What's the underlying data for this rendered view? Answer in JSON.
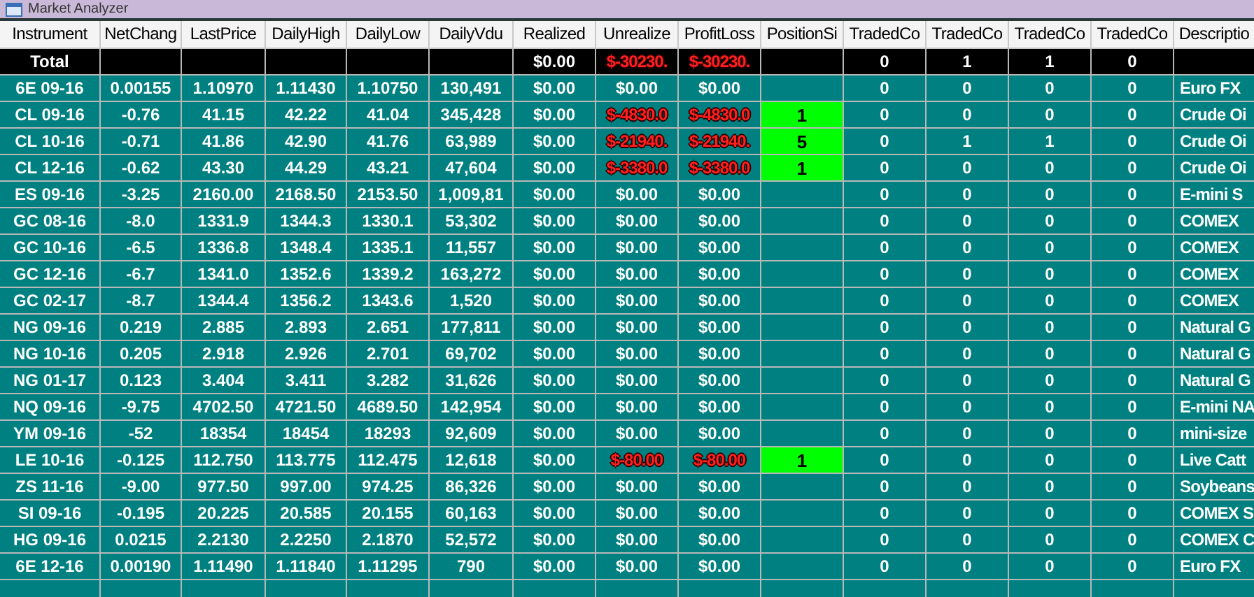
{
  "window": {
    "title": "Market Analyzer"
  },
  "columns": [
    "Instrument",
    "NetChang",
    "LastPrice",
    "DailyHigh",
    "DailyLow",
    "DailyVdu",
    "Realized",
    "Unrealize",
    "ProfitLoss",
    "PositionSi",
    "TradedCo",
    "TradedCo",
    "TradedCo",
    "TradedCo",
    "Descriptio"
  ],
  "rows": [
    {
      "kind": "total",
      "loss": true,
      "position_open": false,
      "cells": [
        "Total",
        null,
        null,
        null,
        null,
        null,
        "$0.00",
        "$-30230.",
        "$-30230.",
        null,
        "0",
        "1",
        "1",
        "0",
        null
      ]
    },
    {
      "kind": "instrument",
      "loss": false,
      "position_open": false,
      "cells": [
        "6E 09-16",
        "0.00155",
        "1.10970",
        "1.11430",
        "1.10750",
        "130,491",
        "$0.00",
        "$0.00",
        "$0.00",
        null,
        "0",
        "0",
        "0",
        "0",
        "Euro FX"
      ]
    },
    {
      "kind": "instrument",
      "loss": true,
      "position_open": true,
      "cells": [
        "CL 09-16",
        "-0.76",
        "41.15",
        "42.22",
        "41.04",
        "345,428",
        "$0.00",
        "$-4830.0",
        "$-4830.0",
        "1",
        "0",
        "0",
        "0",
        "0",
        "Crude Oi"
      ]
    },
    {
      "kind": "instrument",
      "loss": true,
      "position_open": true,
      "cells": [
        "CL 10-16",
        "-0.71",
        "41.86",
        "42.90",
        "41.76",
        "63,989",
        "$0.00",
        "$-21940.",
        "$-21940.",
        "5",
        "0",
        "1",
        "1",
        "0",
        "Crude Oi"
      ]
    },
    {
      "kind": "instrument",
      "loss": true,
      "position_open": true,
      "cells": [
        "CL 12-16",
        "-0.62",
        "43.30",
        "44.29",
        "43.21",
        "47,604",
        "$0.00",
        "$-3380.0",
        "$-3380.0",
        "1",
        "0",
        "0",
        "0",
        "0",
        "Crude Oi"
      ]
    },
    {
      "kind": "instrument",
      "loss": false,
      "position_open": false,
      "cells": [
        "ES 09-16",
        "-3.25",
        "2160.00",
        "2168.50",
        "2153.50",
        "1,009,81",
        "$0.00",
        "$0.00",
        "$0.00",
        null,
        "0",
        "0",
        "0",
        "0",
        "E-mini S"
      ]
    },
    {
      "kind": "instrument",
      "loss": false,
      "position_open": false,
      "cells": [
        "GC 08-16",
        "-8.0",
        "1331.9",
        "1344.3",
        "1330.1",
        "53,302",
        "$0.00",
        "$0.00",
        "$0.00",
        null,
        "0",
        "0",
        "0",
        "0",
        "COMEX"
      ]
    },
    {
      "kind": "instrument",
      "loss": false,
      "position_open": false,
      "cells": [
        "GC 10-16",
        "-6.5",
        "1336.8",
        "1348.4",
        "1335.1",
        "11,557",
        "$0.00",
        "$0.00",
        "$0.00",
        null,
        "0",
        "0",
        "0",
        "0",
        "COMEX"
      ]
    },
    {
      "kind": "instrument",
      "loss": false,
      "position_open": false,
      "cells": [
        "GC 12-16",
        "-6.7",
        "1341.0",
        "1352.6",
        "1339.2",
        "163,272",
        "$0.00",
        "$0.00",
        "$0.00",
        null,
        "0",
        "0",
        "0",
        "0",
        "COMEX"
      ]
    },
    {
      "kind": "instrument",
      "loss": false,
      "position_open": false,
      "cells": [
        "GC 02-17",
        "-8.7",
        "1344.4",
        "1356.2",
        "1343.6",
        "1,520",
        "$0.00",
        "$0.00",
        "$0.00",
        null,
        "0",
        "0",
        "0",
        "0",
        "COMEX"
      ]
    },
    {
      "kind": "instrument",
      "loss": false,
      "position_open": false,
      "cells": [
        "NG 09-16",
        "0.219",
        "2.885",
        "2.893",
        "2.651",
        "177,811",
        "$0.00",
        "$0.00",
        "$0.00",
        null,
        "0",
        "0",
        "0",
        "0",
        "Natural G"
      ]
    },
    {
      "kind": "instrument",
      "loss": false,
      "position_open": false,
      "cells": [
        "NG 10-16",
        "0.205",
        "2.918",
        "2.926",
        "2.701",
        "69,702",
        "$0.00",
        "$0.00",
        "$0.00",
        null,
        "0",
        "0",
        "0",
        "0",
        "Natural G"
      ]
    },
    {
      "kind": "instrument",
      "loss": false,
      "position_open": false,
      "cells": [
        "NG 01-17",
        "0.123",
        "3.404",
        "3.411",
        "3.282",
        "31,626",
        "$0.00",
        "$0.00",
        "$0.00",
        null,
        "0",
        "0",
        "0",
        "0",
        "Natural G"
      ]
    },
    {
      "kind": "instrument",
      "loss": false,
      "position_open": false,
      "cells": [
        "NQ 09-16",
        "-9.75",
        "4702.50",
        "4721.50",
        "4689.50",
        "142,954",
        "$0.00",
        "$0.00",
        "$0.00",
        null,
        "0",
        "0",
        "0",
        "0",
        "E-mini NA"
      ]
    },
    {
      "kind": "instrument",
      "loss": false,
      "position_open": false,
      "cells": [
        "YM 09-16",
        "-52",
        "18354",
        "18454",
        "18293",
        "92,609",
        "$0.00",
        "$0.00",
        "$0.00",
        null,
        "0",
        "0",
        "0",
        "0",
        "mini-size"
      ]
    },
    {
      "kind": "instrument",
      "loss": true,
      "position_open": true,
      "cells": [
        "LE 10-16",
        "-0.125",
        "112.750",
        "113.775",
        "112.475",
        "12,618",
        "$0.00",
        "$-80.00",
        "$-80.00",
        "1",
        "0",
        "0",
        "0",
        "0",
        "Live Catt"
      ]
    },
    {
      "kind": "instrument",
      "loss": false,
      "position_open": false,
      "cells": [
        "ZS 11-16",
        "-9.00",
        "977.50",
        "997.00",
        "974.25",
        "86,326",
        "$0.00",
        "$0.00",
        "$0.00",
        null,
        "0",
        "0",
        "0",
        "0",
        "Soybeans"
      ]
    },
    {
      "kind": "instrument",
      "loss": false,
      "position_open": false,
      "cells": [
        "SI 09-16",
        "-0.195",
        "20.225",
        "20.585",
        "20.155",
        "60,163",
        "$0.00",
        "$0.00",
        "$0.00",
        null,
        "0",
        "0",
        "0",
        "0",
        "COMEX S"
      ]
    },
    {
      "kind": "instrument",
      "loss": false,
      "position_open": false,
      "cells": [
        "HG 09-16",
        "0.0215",
        "2.2130",
        "2.2250",
        "2.1870",
        "52,572",
        "$0.00",
        "$0.00",
        "$0.00",
        null,
        "0",
        "0",
        "0",
        "0",
        "COMEX C"
      ]
    },
    {
      "kind": "instrument",
      "loss": false,
      "position_open": false,
      "cells": [
        "6E 12-16",
        "0.00190",
        "1.11490",
        "1.11840",
        "1.11295",
        "790",
        "$0.00",
        "$0.00",
        "$0.00",
        null,
        "0",
        "0",
        "0",
        "0",
        "Euro FX"
      ]
    }
  ]
}
